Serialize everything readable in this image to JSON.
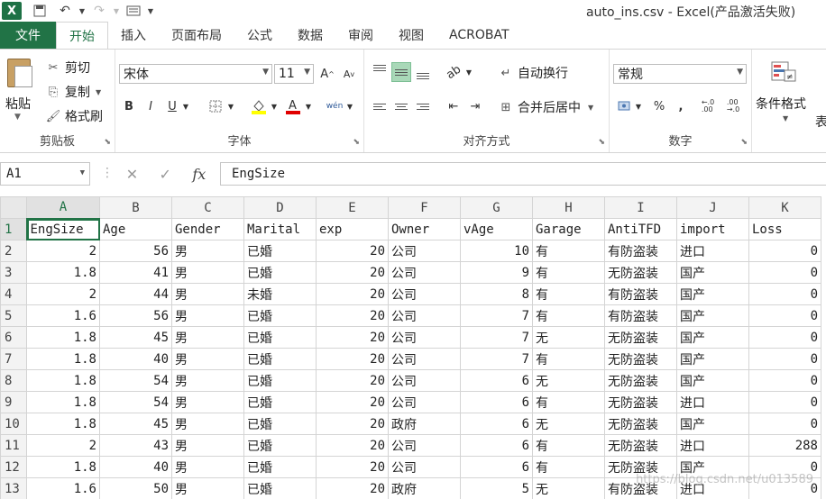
{
  "title": "auto_ins.csv - Excel(产品激活失败)",
  "quick_access": {
    "save_icon": "save-icon",
    "undo_icon": "undo-icon",
    "redo_icon": "redo-icon",
    "customize_icon": "customize-icon"
  },
  "tabs": [
    "文件",
    "开始",
    "插入",
    "页面布局",
    "公式",
    "数据",
    "审阅",
    "视图",
    "ACROBAT"
  ],
  "active_tab": "开始",
  "ribbon": {
    "clipboard": {
      "paste": "粘贴",
      "cut": "剪切",
      "copy": "复制",
      "format_painter": "格式刷",
      "label": "剪贴板"
    },
    "font": {
      "name": "宋体",
      "size": "11",
      "label": "字体",
      "bold": "B",
      "italic": "I",
      "underline": "U",
      "grow": "A",
      "shrink": "A",
      "phonetic": "wén"
    },
    "alignment": {
      "wrap": "自动换行",
      "merge": "合并后居中",
      "label": "对齐方式"
    },
    "number": {
      "format": "常规",
      "percent": "%",
      "comma": ",",
      "inc_decimal": ".00→.0",
      "dec_decimal": ".0→.00",
      "label": "数字"
    },
    "styles": {
      "conditional": "条件格式",
      "table_fragment": "表"
    }
  },
  "formula_bar": {
    "name_box": "A1",
    "cancel": "✕",
    "enter": "✓",
    "fx": "fx",
    "content": "EngSize"
  },
  "columns": [
    "A",
    "B",
    "C",
    "D",
    "E",
    "F",
    "G",
    "H",
    "I",
    "J",
    "K"
  ],
  "rows": [
    [
      "EngSize",
      "Age",
      "Gender",
      "Marital",
      "exp",
      "Owner",
      "vAge",
      "Garage",
      "AntiTFD",
      "import",
      "Loss"
    ],
    [
      "2",
      "56",
      "男",
      "已婚",
      "20",
      "公司",
      "10",
      "有",
      "有防盗装",
      "进口",
      "0"
    ],
    [
      "1.8",
      "41",
      "男",
      "已婚",
      "20",
      "公司",
      "9",
      "有",
      "无防盗装",
      "国产",
      "0"
    ],
    [
      "2",
      "44",
      "男",
      "未婚",
      "20",
      "公司",
      "8",
      "有",
      "有防盗装",
      "国产",
      "0"
    ],
    [
      "1.6",
      "56",
      "男",
      "已婚",
      "20",
      "公司",
      "7",
      "有",
      "有防盗装",
      "国产",
      "0"
    ],
    [
      "1.8",
      "45",
      "男",
      "已婚",
      "20",
      "公司",
      "7",
      "无",
      "无防盗装",
      "国产",
      "0"
    ],
    [
      "1.8",
      "40",
      "男",
      "已婚",
      "20",
      "公司",
      "7",
      "有",
      "无防盗装",
      "国产",
      "0"
    ],
    [
      "1.8",
      "54",
      "男",
      "已婚",
      "20",
      "公司",
      "6",
      "无",
      "无防盗装",
      "国产",
      "0"
    ],
    [
      "1.8",
      "54",
      "男",
      "已婚",
      "20",
      "公司",
      "6",
      "有",
      "无防盗装",
      "进口",
      "0"
    ],
    [
      "1.8",
      "45",
      "男",
      "已婚",
      "20",
      "政府",
      "6",
      "无",
      "无防盗装",
      "国产",
      "0"
    ],
    [
      "2",
      "43",
      "男",
      "已婚",
      "20",
      "公司",
      "6",
      "有",
      "无防盗装",
      "进口",
      "288"
    ],
    [
      "1.8",
      "40",
      "男",
      "已婚",
      "20",
      "公司",
      "6",
      "有",
      "无防盗装",
      "国产",
      "0"
    ],
    [
      "1.6",
      "50",
      "男",
      "已婚",
      "20",
      "政府",
      "5",
      "无",
      "有防盗装",
      "进口",
      "0"
    ]
  ],
  "numeric_columns": [
    0,
    1,
    4,
    6,
    10
  ],
  "watermark": "https://blog.csdn.net/u013589",
  "colors": {
    "accent": "#217346"
  }
}
